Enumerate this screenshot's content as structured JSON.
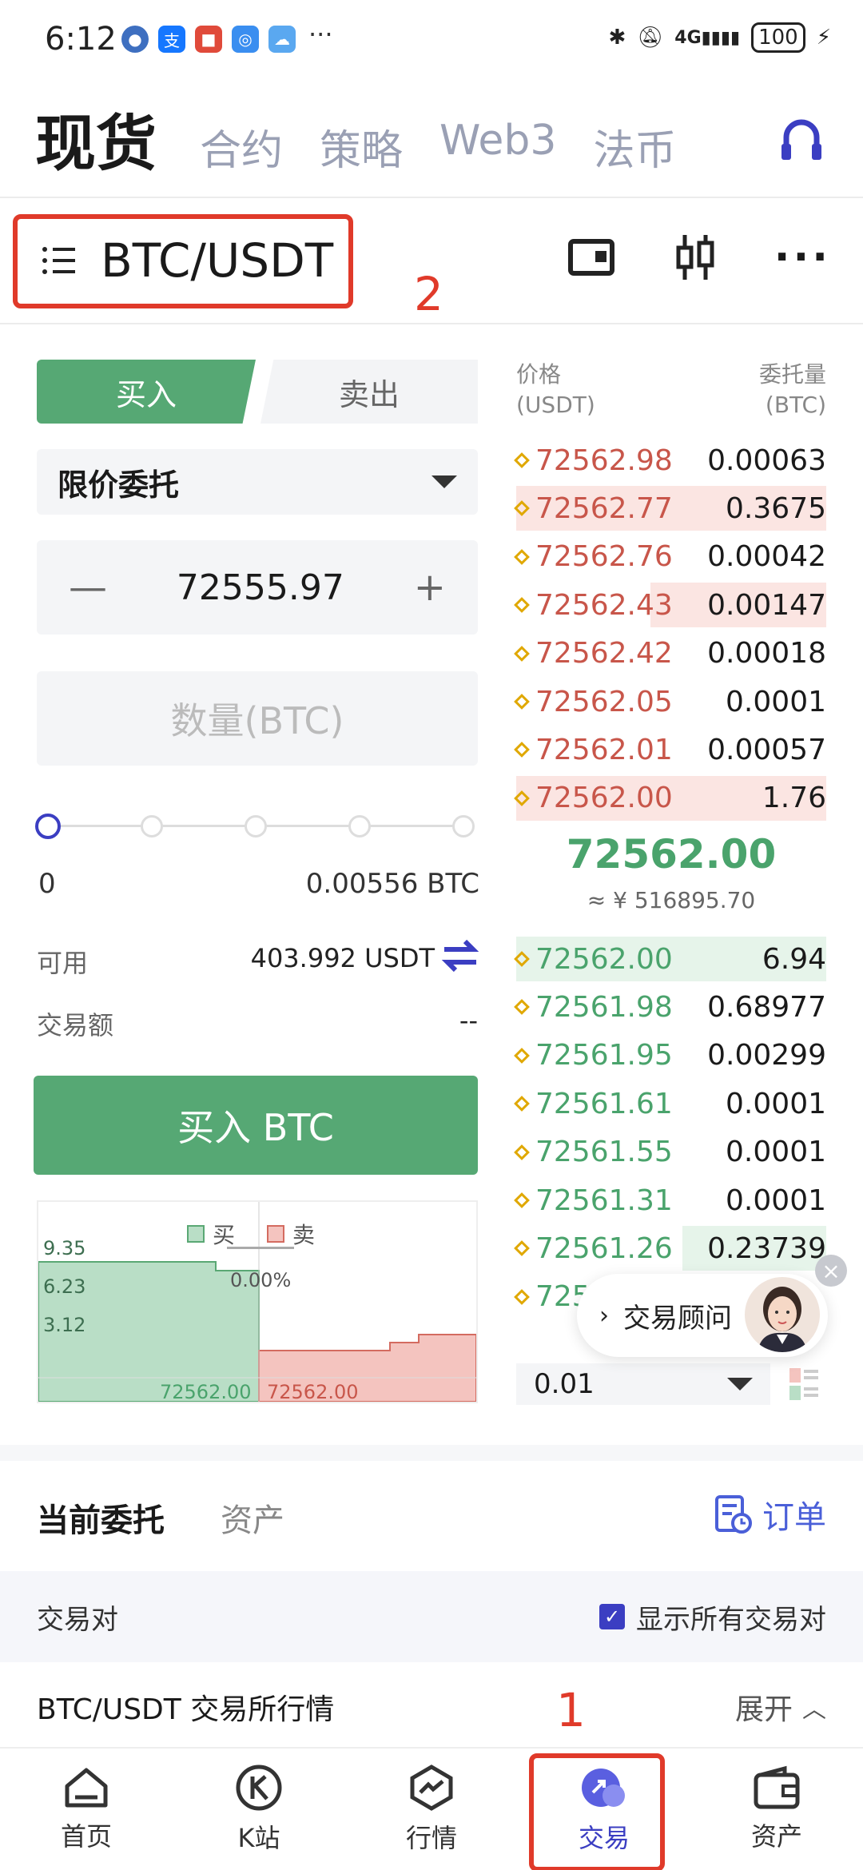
{
  "status_bar": {
    "time": "6:12",
    "network": "4G",
    "battery": "100"
  },
  "top_tabs": {
    "active": "现货",
    "others": [
      "合约",
      "策略",
      "Web3",
      "法币"
    ]
  },
  "pair": {
    "name": "BTC/USDT",
    "annotation_2": "2"
  },
  "trade": {
    "buy_tab": "买入",
    "sell_tab": "卖出",
    "order_type": "限价委托",
    "price": "72555.97",
    "minus": "—",
    "plus": "+",
    "qty_placeholder": "数量(BTC)",
    "slider_min": "0",
    "slider_max": "0.00556 BTC",
    "slider_level": 0,
    "available_label": "可用",
    "available_value": "403.992 USDT",
    "amount_label": "交易额",
    "amount_value": "--",
    "buy_button": "买入 BTC"
  },
  "depth_chart": {
    "legend_buy": "买",
    "legend_sell": "卖",
    "pct": "0.00%",
    "y_ticks": [
      "9.35",
      "6.23",
      "3.12"
    ],
    "bid_price": "72562.00",
    "ask_price": "72562.00"
  },
  "orderbook": {
    "price_header": "价格",
    "price_unit": "(USDT)",
    "qty_header": "委托量",
    "qty_unit": "(BTC)",
    "asks": [
      {
        "price": "72562.98",
        "qty": "0.00063"
      },
      {
        "price": "72562.77",
        "qty": "0.3675"
      },
      {
        "price": "72562.76",
        "qty": "0.00042"
      },
      {
        "price": "72562.43",
        "qty": "0.00147"
      },
      {
        "price": "72562.42",
        "qty": "0.00018"
      },
      {
        "price": "72562.05",
        "qty": "0.0001"
      },
      {
        "price": "72562.01",
        "qty": "0.00057"
      },
      {
        "price": "72562.00",
        "qty": "1.76"
      }
    ],
    "mid_price": "72562.00",
    "mid_cny": "≈ ¥ 516895.70",
    "bids": [
      {
        "price": "72562.00",
        "qty": "6.94"
      },
      {
        "price": "72561.98",
        "qty": "0.68977"
      },
      {
        "price": "72561.95",
        "qty": "0.00299"
      },
      {
        "price": "72561.61",
        "qty": "0.0001"
      },
      {
        "price": "72561.55",
        "qty": "0.0001"
      },
      {
        "price": "72561.31",
        "qty": "0.0001"
      },
      {
        "price": "72561.26",
        "qty": "0.23739"
      },
      {
        "price": "725",
        "qty": ""
      }
    ],
    "precision": "0.01"
  },
  "advisor": {
    "label": "交易顾问"
  },
  "orders": {
    "tab_current": "当前委托",
    "tab_assets": "资产",
    "orders_link": "订单",
    "pair_label": "交易对",
    "show_all": "显示所有交易对",
    "market_label": "BTC/USDT 交易所行情",
    "expand": "展开"
  },
  "annotation_1": "1",
  "bottom_nav": [
    {
      "label": "首页",
      "icon": "home-icon"
    },
    {
      "label": "K站",
      "icon": "k-station-icon"
    },
    {
      "label": "行情",
      "icon": "market-icon"
    },
    {
      "label": "交易",
      "icon": "trade-icon"
    },
    {
      "label": "资产",
      "icon": "wallet-icon"
    }
  ],
  "colors": {
    "buy_green": "#56a874",
    "sell_red": "#c8564a",
    "accent_blue": "#3b3ec2",
    "annotation_red": "#e03a2a"
  }
}
